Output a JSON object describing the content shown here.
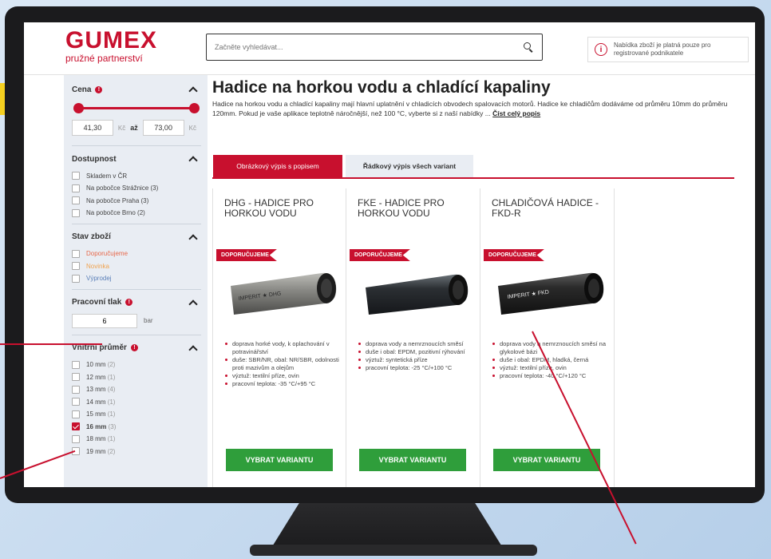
{
  "brand": {
    "name": "GUMEX",
    "tagline": "pružné partnerství",
    "color": "#c8102e"
  },
  "search": {
    "placeholder": "Začněte vyhledávat..."
  },
  "notice": {
    "text": "Nabídka zboží je platná pouze pro registrované podnikatele"
  },
  "filters": {
    "price": {
      "label": "Cena",
      "min": "41,30",
      "max": "73,00",
      "currency": "Kč",
      "sep": "až"
    },
    "availability": {
      "label": "Dostupnost",
      "items": [
        "Skladem v ČR",
        "Na pobočce Strážnice (3)",
        "Na pobočce Praha (3)",
        "Na pobočce Brno (2)"
      ]
    },
    "state": {
      "label": "Stav zboží",
      "items": [
        "Doporučujeme",
        "Novinka",
        "Výprodej"
      ]
    },
    "pressure": {
      "label": "Pracovní tlak",
      "value": "6",
      "unit": "bar"
    },
    "diameter": {
      "label": "Vnitřní průměr",
      "items": [
        {
          "label": "10 mm",
          "count": "(2)"
        },
        {
          "label": "12 mm",
          "count": "(1)"
        },
        {
          "label": "13 mm",
          "count": "(4)"
        },
        {
          "label": "14 mm",
          "count": "(1)"
        },
        {
          "label": "15 mm",
          "count": "(1)"
        },
        {
          "label": "16 mm",
          "count": "(3)",
          "checked": true
        },
        {
          "label": "18 mm",
          "count": "(1)"
        },
        {
          "label": "19 mm",
          "count": "(2)"
        }
      ]
    }
  },
  "page": {
    "title": "Hadice na horkou vodu a chladící kapaliny",
    "description": "Hadice na horkou vodu a chladící kapaliny mají hlavní uplatnění v chladicích obvodech spalovacích motorů. Hadice ke chladičům dodáváme od průměru 10mm do průměru 120mm. Pokud je vaše aplikace teplotně náročnější, než 100 °C, vyberte si z naší nabídky ...",
    "read_more": "Číst celý popis"
  },
  "tabs": [
    "Obrázkový výpis s popisem",
    "Řádkový výpis všech variant"
  ],
  "products": [
    {
      "name": "DHG - HADICE PRO HORKOU VODU",
      "tag": "DOPORUČUJEME",
      "features": [
        "doprava horké vody, k oplachování v potravinářství",
        "duše: SBR/NR, obal: NR/SBR, odolnosti proti mazivům a olejům",
        "výztuž: textilní příze, ovin",
        "pracovní teplota: -35 °C/+95 °C"
      ],
      "button": "VYBRAT VARIANTU",
      "hose_color": "#8a8a86",
      "print": "IMPERIT ★ DHG"
    },
    {
      "name": "FKE - HADICE PRO HORKOU VODU",
      "tag": "DOPORUČUJEME",
      "features": [
        "doprava vody a nemrznoucích směsí",
        "duše i obal: EPDM, pozitivní rýhování",
        "výztuž: syntetická příze",
        "pracovní teplota: -25 °C/+100 °C"
      ],
      "button": "VYBRAT VARIANTU",
      "hose_color": "#2b2f33",
      "print": ""
    },
    {
      "name": "CHLADIČOVÁ HADICE - FKD-R",
      "tag": "DOPORUČUJEME",
      "features": [
        "doprava vody a nemrznoucích směsí na glykolové bázi",
        "duše i obal: EPDM, hladká, černá",
        "výztuž: textilní příze, ovin",
        "pracovní teplota: -40 °C/+120 °C"
      ],
      "button": "VYBRAT VARIANTU",
      "hose_color": "#2a2a2a",
      "print": "IMPERIT ★ FKD"
    }
  ]
}
